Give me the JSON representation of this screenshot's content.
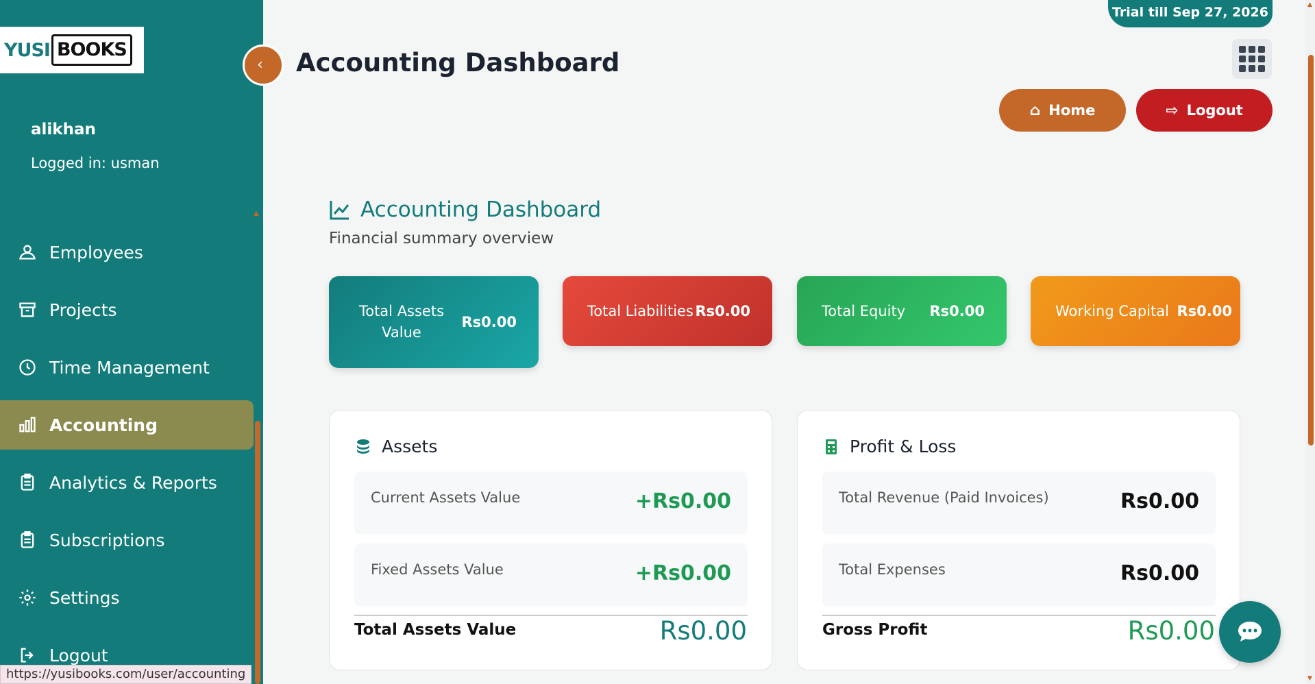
{
  "brand": {
    "part1": "YUSI",
    "part2": "BOOKS"
  },
  "user": {
    "name": "alikhan",
    "logged_in": "Logged in: usman"
  },
  "sidebar": {
    "items": [
      {
        "label": "Employees",
        "icon": "employees-icon"
      },
      {
        "label": "Projects",
        "icon": "archive-icon"
      },
      {
        "label": "Time Management",
        "icon": "clock-icon"
      },
      {
        "label": "Accounting",
        "icon": "bar-chart-icon",
        "active": true
      },
      {
        "label": "Analytics & Reports",
        "icon": "clipboard-icon"
      },
      {
        "label": "Subscriptions",
        "icon": "clipboard-icon"
      },
      {
        "label": "Settings",
        "icon": "gear-icon"
      },
      {
        "label": "Logout",
        "icon": "logout-icon"
      }
    ]
  },
  "status_url": "https://yusibooks.com/user/accounting",
  "header": {
    "trial": "Trial till Sep 27, 2026",
    "title": "Accounting Dashboard",
    "home_label": "Home",
    "logout_label": "Logout"
  },
  "section": {
    "title": "Accounting Dashboard",
    "subtitle": "Financial summary overview"
  },
  "stats": [
    {
      "label": "Total Assets Value",
      "value": "Rs0.00",
      "color": "#137c7b"
    },
    {
      "label": "Total Liabilities",
      "value": "Rs0.00",
      "color": "#d93d32"
    },
    {
      "label": "Total Equity",
      "value": "Rs0.00",
      "color": "#2db862"
    },
    {
      "label": "Working Capital",
      "value": "Rs0.00",
      "color": "#ee8a1a"
    }
  ],
  "assets_panel": {
    "title": "Assets",
    "rows": [
      {
        "label": "Current Assets Value",
        "value": "+Rs0.00"
      },
      {
        "label": "Fixed Assets Value",
        "value": "+Rs0.00"
      }
    ],
    "total_label": "Total Assets Value",
    "total_value": "Rs0.00"
  },
  "pl_panel": {
    "title": "Profit & Loss",
    "rows": [
      {
        "label": "Total Revenue (Paid Invoices)",
        "value": "Rs0.00"
      },
      {
        "label": "Total Expenses",
        "value": "Rs0.00"
      }
    ],
    "total_label": "Gross Profit",
    "total_value": "Rs0.00"
  }
}
